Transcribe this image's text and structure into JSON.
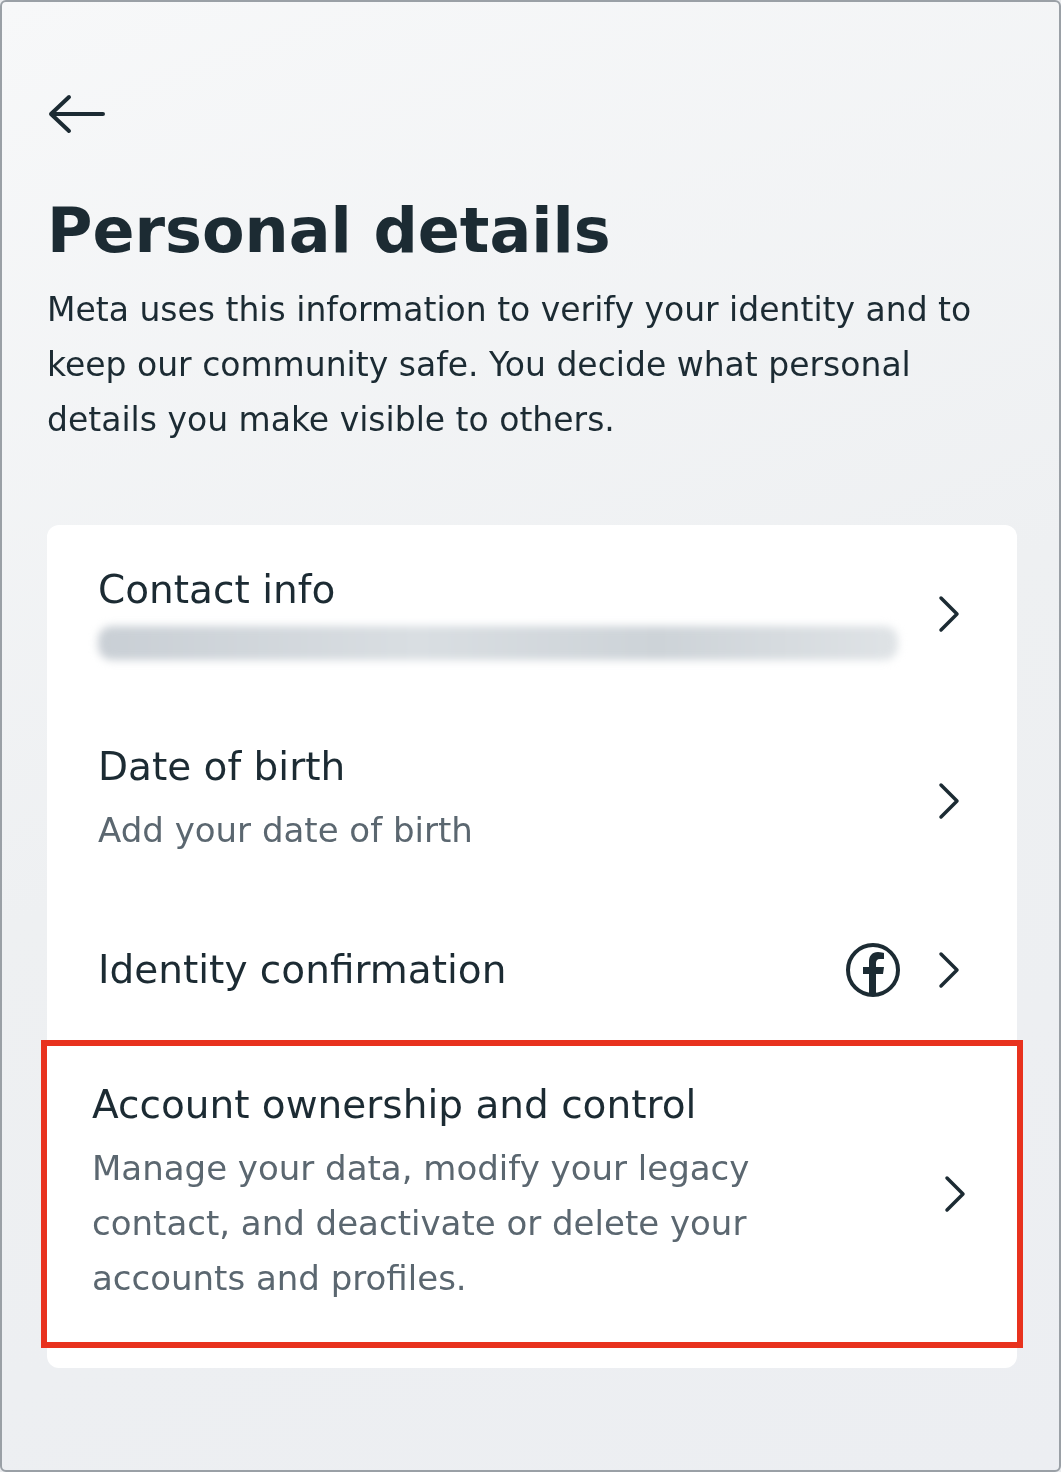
{
  "header": {
    "title": "Personal details",
    "description": "Meta uses this information to verify your identity and to keep our community safe. You decide what personal details you make visible to others."
  },
  "items": [
    {
      "title": "Contact info",
      "subtitle_blurred": true,
      "highlighted": false,
      "facebook_badge": false
    },
    {
      "title": "Date of birth",
      "subtitle": "Add your date of birth",
      "highlighted": false,
      "facebook_badge": false
    },
    {
      "title": "Identity confirmation",
      "highlighted": false,
      "facebook_badge": true
    },
    {
      "title": "Account ownership and control",
      "subtitle": "Manage your data, modify your legacy contact, and deactivate or delete your accounts and profiles.",
      "highlighted": true,
      "facebook_badge": false
    }
  ]
}
